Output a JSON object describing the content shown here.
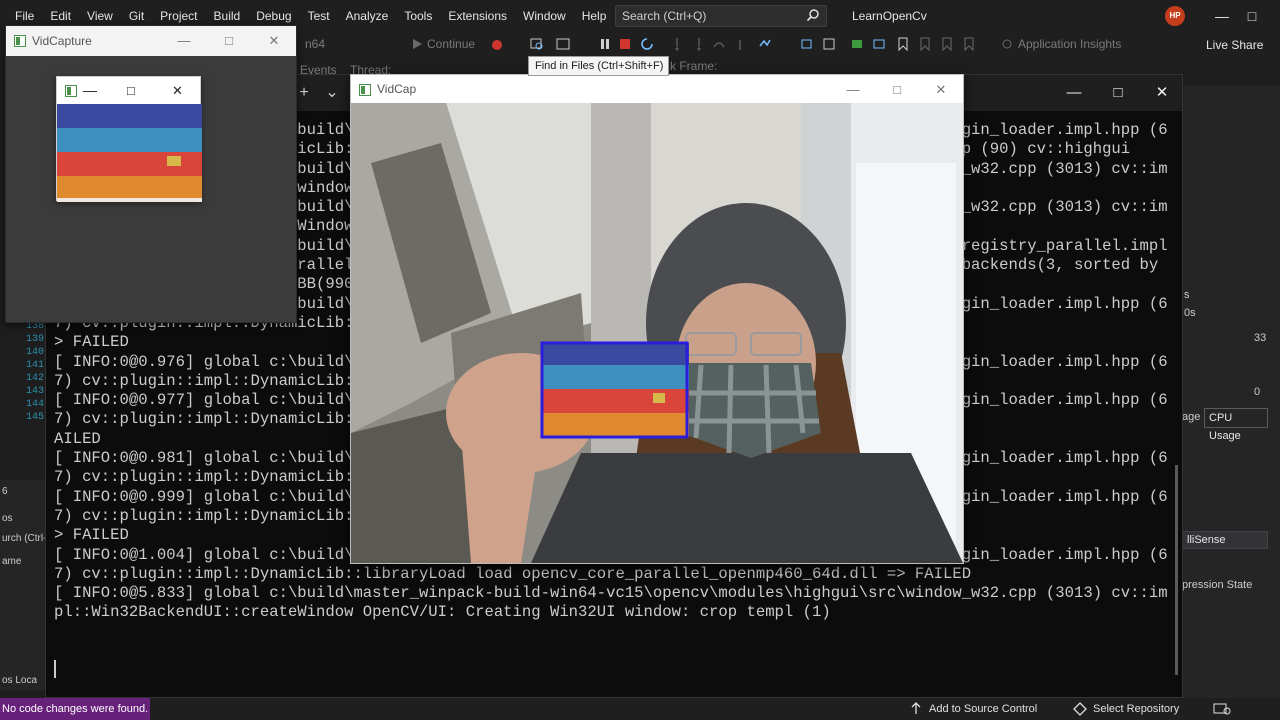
{
  "menubar": {
    "items": [
      "File",
      "Edit",
      "View",
      "Git",
      "Project",
      "Build",
      "Debug",
      "Test",
      "Analyze",
      "Tools",
      "Extensions",
      "Window",
      "Help"
    ],
    "search_placeholder": "Search (Ctrl+Q)",
    "solution_name": "LearnOpenCv",
    "avatar_initials": "HP"
  },
  "toolbar": {
    "platform_fragment": "n64",
    "continue_label": "Continue",
    "events_fragment": "Events",
    "thread_label": "Thread:",
    "stack_frame_fragment": "k Frame:",
    "app_insights": "Application Insights",
    "live_share": "Live Share",
    "tooltip": "Find in Files (Ctrl+Shift+F)"
  },
  "editor": {
    "line_numbers": [
      "138",
      "139",
      "140",
      "141",
      "142",
      "143",
      "144",
      "145"
    ]
  },
  "left_panel": {
    "row1": "6",
    "row2": "os",
    "row3": "urch (Ctrl-",
    "row4": "ame",
    "tab1": "os",
    "tab2": "Loca"
  },
  "right_panel": {
    "process_label": "s",
    "timeline_label": "0s",
    "cpu_max": "33",
    "cpu_min": "0",
    "memory_tab": "age",
    "cpu_tab": "CPU Usage",
    "intellisense": "lliSense",
    "suppression": "pression State"
  },
  "console": {
    "lines": [
      "[ INFO:0@0.972] global c:\\build\\master_winpack-build-win64-vc15\\opencv\\modules\\core\\src\\utils\\plugin_loader.impl.hpp (6",
      "7) cv::plugin::impl::DynamicLib::libraryLoad load opencv_highgui_msmf460_64d.dll => FAILED  cv.cpp (90) cv::highgui",
      "[ INFO:0@0.973] global c:\\build\\master_winpack-build-win64-vc15\\opencv\\modules\\highgui\\src\\window_w32.cpp (3013) cv::im",
      "pl::Win32BackendUI: using window_w32 backend  highgui\\src\\window_w32.cpp (3013) cv::im",
      "[ INFO:0@0.973] global c:\\build\\master_winpack-build-win64-vc15\\opencv\\modules\\highgui\\src\\window_w32.cpp (3013) cv::im",
      "pl::Win32BackendUI::createWindow OpenCV/UI: Creating Win32UI window: VidCap",
      "[ INFO:0@0.973] global c:\\build\\master_winpack-build-win64-vc15\\opencv\\modules\\core\\src\\parallel\\registry_parallel.impl",
      ".hpp (96) cv::parallel::ParallelBackendRegistry::ParallelBackendRegistry core(parallel): Enabled backends(3, sorted by",
      "priority): ONETBB(1000); TBB(990); OPENMP(980)",
      "[ INFO:0@0.974] global c:\\build\\master_winpack-build-win64-vc15\\opencv\\modules\\core\\src\\utils\\plugin_loader.impl.hpp (6",
      "7) cv::plugin::impl::DynamicLib::libraryLoad load opencv_core_parallel_onetbb460_64d.dll =",
      "> FAILED",
      "[ INFO:0@0.976] global c:\\build\\master_winpack-build-win64-vc15\\opencv\\modules\\core\\src\\utils\\plugin_loader.impl.hpp (6",
      "7) cv::plugin::impl::DynamicLib::libraryLoad load opencv_core_parallel_onetbb460_64d.dll =",
      "[ INFO:0@0.977] global c:\\build\\master_winpack-build-win64-vc15\\opencv\\modules\\core\\src\\utils\\plugin_loader.impl.hpp (6",
      "7) cv::plugin::impl::DynamicLib::libraryLoad load opencv_core_parallel_tbb460_64d.dll => F",
      "AILED",
      "[ INFO:0@0.981] global c:\\build\\master_winpack-build-win64-vc15\\opencv\\modules\\core\\src\\utils\\plugin_loader.impl.hpp (6",
      "7) cv::plugin::impl::DynamicLib::libraryLoad load opencv_core_parallel_tbb460_64d.dll",
      "[ INFO:0@0.999] global c:\\build\\master_winpack-build-win64-vc15\\opencv\\modules\\core\\src\\utils\\plugin_loader.impl.hpp (6",
      "7) cv::plugin::impl::DynamicLib::libraryLoad load opencv_core_parallel_openmp460_64d.dll =",
      "> FAILED",
      "[ INFO:0@1.004] global c:\\build\\master_winpack-build-win64-vc15\\opencv\\modules\\core\\src\\utils\\plugin_loader.impl.hpp (6",
      "7) cv::plugin::impl::DynamicLib::libraryLoad load opencv_core_parallel_openmp460_64d.dll => FAILED",
      "[ INFO:0@5.833] global c:\\build\\master_winpack-build-win64-vc15\\opencv\\modules\\highgui\\src\\window_w32.cpp (3013) cv::im",
      "pl::Win32BackendUI::createWindow OpenCV/UI: Creating Win32UI window: crop templ (1)"
    ]
  },
  "vidcapture": {
    "title": "VidCapture"
  },
  "vidcap": {
    "title": "VidCap"
  },
  "statusbar": {
    "message": "No code changes were found.",
    "source_control": "Add to Source Control",
    "repository": "Select Repository"
  },
  "colors": {
    "accent": "#68217a",
    "detection_box": "#2b1ddb",
    "avatar": "#c43e1c"
  }
}
